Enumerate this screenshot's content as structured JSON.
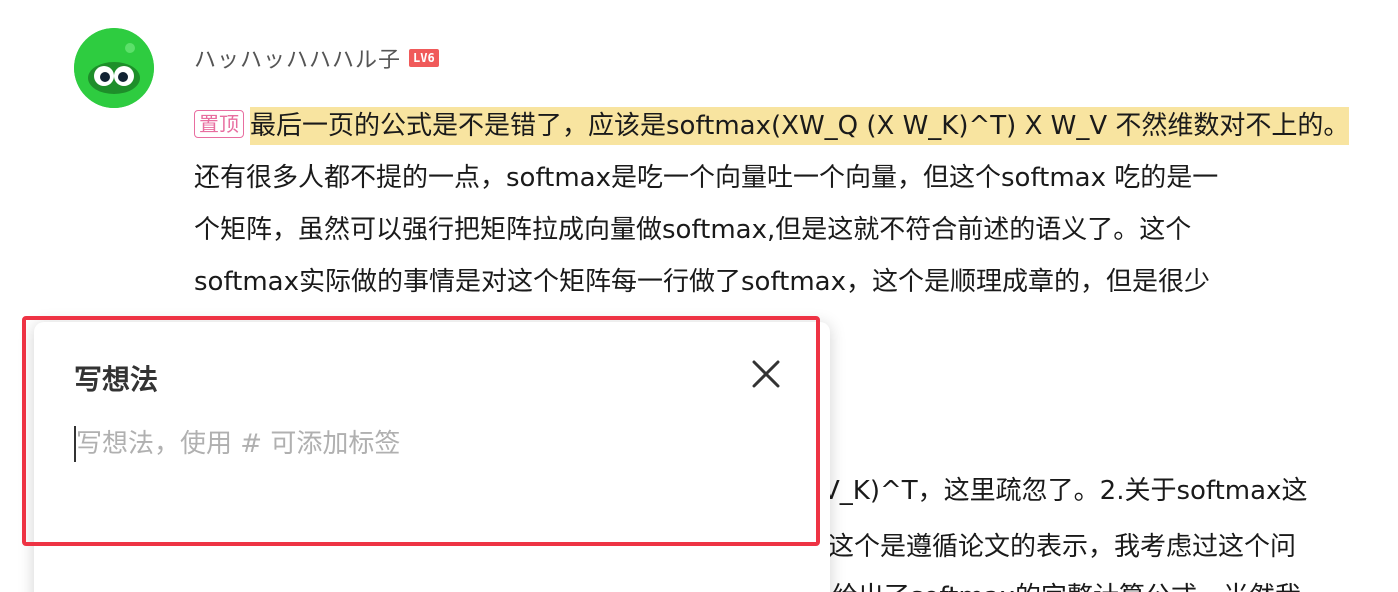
{
  "comment": {
    "username": "ハッハッハハハル子",
    "level": "LV6",
    "pin_label": "置顶",
    "highlight_text": "最后一页的公式是不是错了，应该是softmax(XW_Q (X W_K)^T) X W_V 不然维数对不上的。",
    "body_line1": "还有很多人都不提的一点，softmax是吃一个向量吐一个向量，但这个softmax 吃的是一",
    "body_line2": "个矩阵，虽然可以强行把矩阵拉成向量做softmax,但是这就不符合前述的语义了。这个",
    "body_line3": "softmax实际做的事情是对这个矩阵每一行做了softmax，这个是顺理成章的，但是很少",
    "reply_fragment1": "V_K)^T，这里疏忽了。2.关于softmax这",
    "reply_fragment2": "这个是遵循论文的表示，我考虑过这个问",
    "reply_fragment3": "给出了softmax的完整计算公式，当然我"
  },
  "popup": {
    "title": "写想法",
    "input_placeholder": "写想法，使用 # 可添加标签",
    "input_value": ""
  },
  "colors": {
    "highlight": "#f8e4a0",
    "pin": "#e86ea0",
    "level_badge": "#f05a5a",
    "red_box": "#ee3344",
    "avatar": "#2ecc40"
  }
}
